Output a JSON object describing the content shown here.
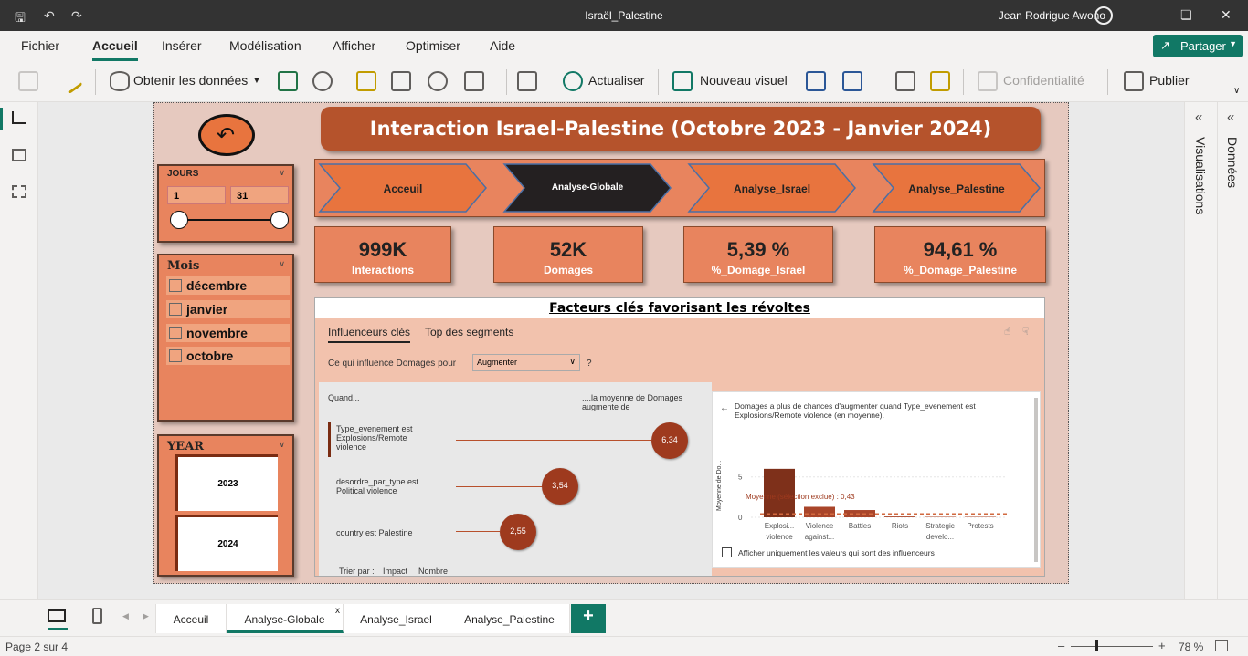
{
  "window": {
    "title": "Israël_Palestine",
    "user": "Jean Rodrigue Awono"
  },
  "ribbon": {
    "tabs": [
      "Fichier",
      "Accueil",
      "Insérer",
      "Modélisation",
      "Afficher",
      "Optimiser",
      "Aide"
    ],
    "active_tab": "Accueil",
    "share_label": "Partager"
  },
  "toolbar": {
    "get_data": "Obtenir les données",
    "refresh": "Actualiser",
    "new_visual": "Nouveau visuel",
    "sensitivity": "Confidentialité",
    "publish": "Publier"
  },
  "right_panel": {
    "visualizations": "Visualisations",
    "data": "Données"
  },
  "report": {
    "title": "Interaction Israel-Palestine (Octobre 2023 - Janvier 2024)",
    "nav_buttons": [
      "Acceuil",
      "Analyse-Globale",
      "Analyse_Israel",
      "Analyse_Palestine"
    ],
    "days_slicer": {
      "label": "JOURS",
      "from": "1",
      "to": "31"
    },
    "month_slicer": {
      "label": "Mois",
      "items": [
        "décembre",
        "janvier",
        "novembre",
        "octobre"
      ]
    },
    "year_slicer": {
      "label": "YEAR",
      "items": [
        "2023",
        "2024"
      ]
    },
    "kpis": [
      {
        "value": "999K",
        "label": "Interactions"
      },
      {
        "value": "52K",
        "label": "Domages"
      },
      {
        "value": "5,39 %",
        "label": "%_Domage_Israel"
      },
      {
        "value": "94,61 %",
        "label": "%_Domage_Palestine"
      }
    ],
    "key_influencers": {
      "title": "Facteurs clés favorisant les révoltes",
      "tab_influencers": "Influenceurs clés",
      "tab_segments": "Top des segments",
      "question_prefix": "Ce qui influence Domages pour",
      "question_dropdown": "Augmenter",
      "question_suffix": "?",
      "col_when": "Quand...",
      "col_avg": "....la moyenne de Domages augmente de",
      "influencers": [
        {
          "label": "Type_evenement est Explosions/Remote violence",
          "value": "6,34"
        },
        {
          "label": "desordre_par_type est Political violence",
          "value": "3,54"
        },
        {
          "label": "country est Palestine",
          "value": "2,55"
        }
      ],
      "sort_label": "Trier par :",
      "sort_impact": "Impact",
      "sort_count": "Nombre",
      "detail_text": "Domages a plus de chances d'augmenter quand Type_evenement est Explosions/Remote violence (en moyenne).",
      "detail_yaxis": "Moyenne de Do...",
      "detail_avg": "Moyenne (sélection exclue) : 0,43",
      "detail_checkbox": "Afficher uniquement les valeurs qui sont des influenceurs"
    }
  },
  "chart_data": {
    "type": "bar",
    "categories": [
      "Explosi... violence",
      "Violence against...",
      "Battles",
      "Riots",
      "Strategic develo...",
      "Protests"
    ],
    "values": [
      6.0,
      1.3,
      0.9,
      0.1,
      0.05,
      0.02
    ],
    "ylabel": "Moyenne de Do...",
    "yticks": [
      "0",
      "5"
    ],
    "reference_line": 0.43,
    "ylim": [
      0,
      7
    ]
  },
  "pages": {
    "tabs": [
      "Acceuil",
      "Analyse-Globale",
      "Analyse_Israel",
      "Analyse_Palestine"
    ],
    "active": "Analyse-Globale",
    "close_glyph": "x",
    "add_glyph": "+"
  },
  "status": {
    "page": "Page 2 sur 4",
    "zoom": "78 %"
  },
  "colors": {
    "accent": "#117865",
    "header_bg": "#b5532c",
    "card": "#e8845e",
    "bar": "#7e301a"
  }
}
